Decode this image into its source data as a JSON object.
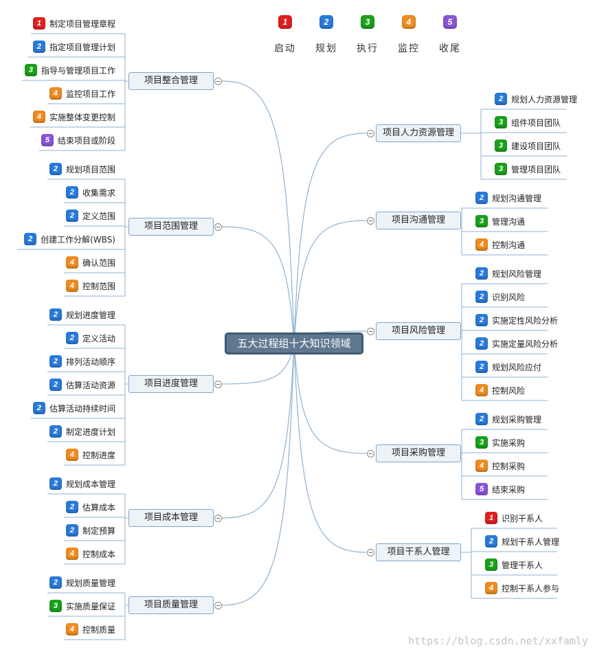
{
  "colors": {
    "1": "#e02020",
    "2": "#2a7bd9",
    "3": "#1aa11a",
    "4": "#ef8c22",
    "5": "#8a55d8"
  },
  "legend": [
    {
      "num": "1",
      "label": "启动"
    },
    {
      "num": "2",
      "label": "规划"
    },
    {
      "num": "3",
      "label": "执行"
    },
    {
      "num": "4",
      "label": "监控"
    },
    {
      "num": "5",
      "label": "收尾"
    }
  ],
  "central_topic": "五大过程组十大知识领域",
  "branches": [
    {
      "label": "项目整合管理",
      "items": [
        {
          "num": "1",
          "text": "制定项目管理章程"
        },
        {
          "num": "2",
          "text": "指定项目管理计划"
        },
        {
          "num": "3",
          "text": "指导与管理项目工作"
        },
        {
          "num": "4",
          "text": "监控项目工作"
        },
        {
          "num": "4",
          "text": "实施整体变更控制"
        },
        {
          "num": "5",
          "text": "结束项目或阶段"
        }
      ]
    },
    {
      "label": "项目范围管理",
      "items": [
        {
          "num": "2",
          "text": "规划项目范围"
        },
        {
          "num": "2",
          "text": "收集需求"
        },
        {
          "num": "2",
          "text": "定义范围"
        },
        {
          "num": "2",
          "text": "创建工作分解(WBS)"
        },
        {
          "num": "4",
          "text": "确认范围"
        },
        {
          "num": "4",
          "text": "控制范围"
        }
      ]
    },
    {
      "label": "项目进度管理",
      "items": [
        {
          "num": "2",
          "text": "规划进度管理"
        },
        {
          "num": "2",
          "text": "定义活动"
        },
        {
          "num": "2",
          "text": "排列活动顺序"
        },
        {
          "num": "2",
          "text": "估算活动资源"
        },
        {
          "num": "2",
          "text": "估算活动持续时间"
        },
        {
          "num": "2",
          "text": "制定进度计划"
        },
        {
          "num": "4",
          "text": "控制进度"
        }
      ]
    },
    {
      "label": "项目成本管理",
      "items": [
        {
          "num": "2",
          "text": "规划成本管理"
        },
        {
          "num": "2",
          "text": "估算成本"
        },
        {
          "num": "2",
          "text": "制定预算"
        },
        {
          "num": "4",
          "text": "控制成本"
        }
      ]
    },
    {
      "label": "项目质量管理",
      "items": [
        {
          "num": "2",
          "text": "规划质量管理"
        },
        {
          "num": "3",
          "text": "实施质量保证"
        },
        {
          "num": "4",
          "text": "控制质量"
        }
      ]
    },
    {
      "label": "项目人力资源管理",
      "items": [
        {
          "num": "2",
          "text": "规划人力资源管理"
        },
        {
          "num": "3",
          "text": "组件项目团队"
        },
        {
          "num": "3",
          "text": "建设项目团队"
        },
        {
          "num": "3",
          "text": "管理项目团队"
        }
      ]
    },
    {
      "label": "项目沟通管理",
      "items": [
        {
          "num": "2",
          "text": "规划沟通管理"
        },
        {
          "num": "3",
          "text": "管理沟通"
        },
        {
          "num": "4",
          "text": "控制沟通"
        }
      ]
    },
    {
      "label": "项目风险管理",
      "items": [
        {
          "num": "2",
          "text": "规划风险管理"
        },
        {
          "num": "2",
          "text": "识别风险"
        },
        {
          "num": "2",
          "text": "实施定性风险分析"
        },
        {
          "num": "2",
          "text": "实施定量风险分析"
        },
        {
          "num": "2",
          "text": "规划风险应付"
        },
        {
          "num": "4",
          "text": "控制风险"
        }
      ]
    },
    {
      "label": "项目采购管理",
      "items": [
        {
          "num": "2",
          "text": "规划采购管理"
        },
        {
          "num": "3",
          "text": "实施采购"
        },
        {
          "num": "4",
          "text": "控制采购"
        },
        {
          "num": "5",
          "text": "结束采购"
        }
      ]
    },
    {
      "label": "项目干系人管理",
      "items": [
        {
          "num": "1",
          "text": "识别干系人"
        },
        {
          "num": "2",
          "text": "规划干系人管理"
        },
        {
          "num": "3",
          "text": "管理干系人"
        },
        {
          "num": "4",
          "text": "控制干系人参与"
        }
      ]
    }
  ],
  "watermark": "https://blog.csdn.net/xxfamly"
}
